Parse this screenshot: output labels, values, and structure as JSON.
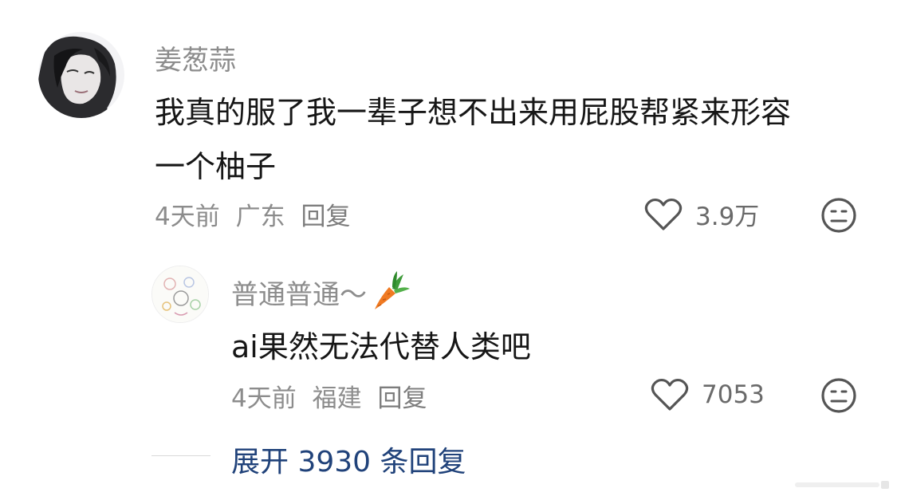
{
  "comments": [
    {
      "username": "姜葱蒜",
      "content_lines": [
        "我真的服了我一辈子想不出来用屁股帮紧来形容",
        "一个柚子"
      ],
      "time": "4天前",
      "location": "广东",
      "reply_label": "回复",
      "like_count": "3.9万",
      "like_icon": "heart-outline-icon",
      "dislike_icon": "neutral-face-icon"
    },
    {
      "username": "普通普通～",
      "username_emoji": "carrot-icon",
      "content_lines": [
        "ai果然无法代替人类吧"
      ],
      "time": "4天前",
      "location": "福建",
      "reply_label": "回复",
      "like_count": "7053",
      "like_icon": "heart-outline-icon",
      "dislike_icon": "neutral-face-icon"
    }
  ],
  "expand_replies": "展开 3930 条回复",
  "colors": {
    "username": "#8c8c8c",
    "content": "#161616",
    "meta": "#8c8c8c",
    "expand_link": "#20427a",
    "icon_stroke": "#555555"
  }
}
